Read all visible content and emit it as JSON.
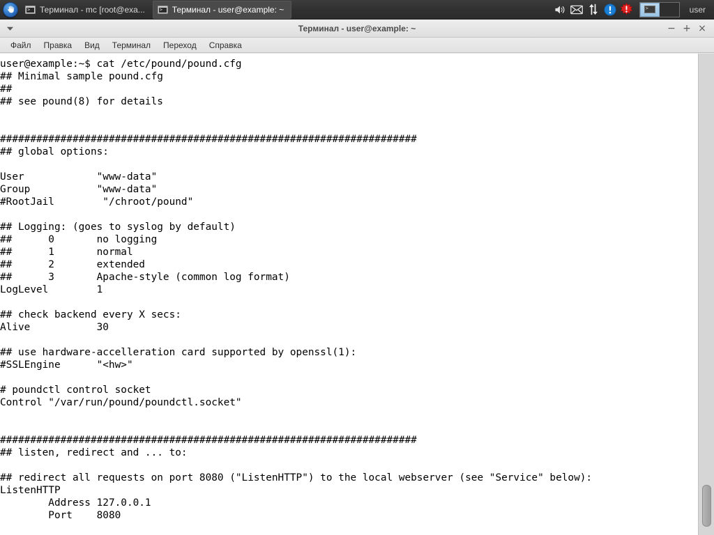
{
  "taskbar": {
    "start_icon": "start-menu-hand-icon",
    "tasks": [
      {
        "icon": "terminal-icon",
        "label": "Терминал - mc [root@exa...",
        "active": false
      },
      {
        "icon": "terminal-icon",
        "label": "Терминал - user@example: ~",
        "active": true
      }
    ],
    "tray": {
      "icons": [
        {
          "name": "volume-icon",
          "glyph": "🔊"
        },
        {
          "name": "mail-icon",
          "glyph": "✉"
        },
        {
          "name": "network-icon",
          "glyph": "⇅"
        },
        {
          "name": "info-icon",
          "glyph": "!"
        },
        {
          "name": "alert-icon",
          "glyph": "!"
        }
      ],
      "pager": {
        "desktops": 2,
        "active": 1
      },
      "user_label": "user"
    }
  },
  "window": {
    "title": "Терминал - user@example: ~",
    "menu_arrow_icon": "chevron-down-icon",
    "controls": {
      "minimize": "−",
      "maximize": "+",
      "close": "×"
    },
    "menu": [
      "Файл",
      "Правка",
      "Вид",
      "Терминал",
      "Переход",
      "Справка"
    ]
  },
  "terminal": {
    "prompt": "user@example:~$",
    "command": "cat /etc/pound/pound.cfg",
    "content": "user@example:~$ cat /etc/pound/pound.cfg\n## Minimal sample pound.cfg\n##\n## see pound(8) for details\n\n\n#####################################################################\n## global options:\n\nUser            \"www-data\"\nGroup           \"www-data\"\n#RootJail        \"/chroot/pound\"\n\n## Logging: (goes to syslog by default)\n##      0       no logging\n##      1       normal\n##      2       extended\n##      3       Apache-style (common log format)\nLogLevel        1\n\n## check backend every X secs:\nAlive           30\n\n## use hardware-accelleration card supported by openssl(1):\n#SSLEngine      \"<hw>\"\n\n# poundctl control socket\nControl \"/var/run/pound/poundctl.socket\"\n\n\n#####################################################################\n## listen, redirect and ... to:\n\n## redirect all requests on port 8080 (\"ListenHTTP\") to the local webserver (see \"Service\" below):\nListenHTTP\n        Address 127.0.0.1\n        Port    8080"
  },
  "scrollbar": {
    "orientation": "vertical",
    "thumb_position": "near-bottom"
  }
}
